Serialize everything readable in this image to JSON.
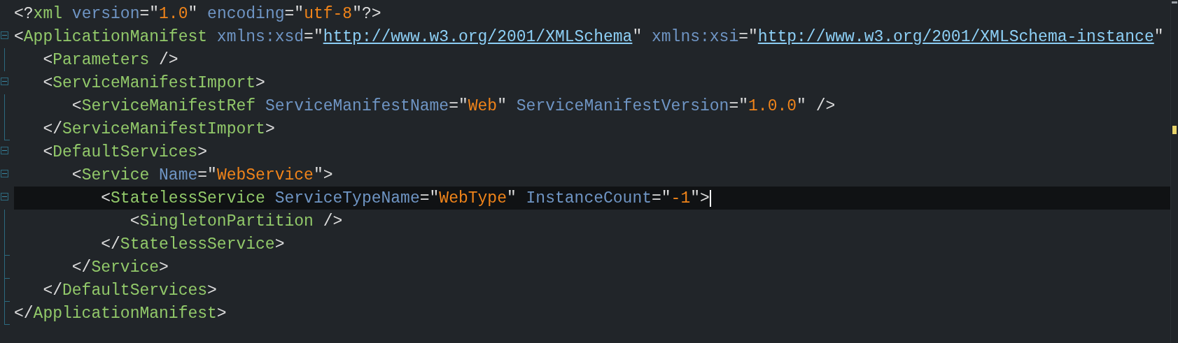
{
  "editor": {
    "lines": [
      {
        "current": false,
        "open": [
          {
            "kind": "punct",
            "text": "<?"
          },
          {
            "kind": "tag",
            "text": "xml"
          },
          {
            "kind": "attr",
            "text": " version"
          },
          {
            "kind": "punct",
            "text": "=\""
          },
          {
            "kind": "value",
            "text": "1.0"
          },
          {
            "kind": "punct",
            "text": "\""
          },
          {
            "kind": "attr",
            "text": " encoding"
          },
          {
            "kind": "punct",
            "text": "=\""
          },
          {
            "kind": "value",
            "text": "utf-8"
          },
          {
            "kind": "punct",
            "text": "\"?>"
          }
        ]
      },
      {
        "current": false,
        "expanded": true,
        "open": [
          {
            "kind": "punct",
            "text": "<"
          },
          {
            "kind": "tag",
            "text": "ApplicationManifest"
          },
          {
            "kind": "attr",
            "text": " xmlns:xsd"
          },
          {
            "kind": "punct",
            "text": "=\""
          },
          {
            "kind": "link",
            "text": "http://www.w3.org/2001/XMLSchema"
          },
          {
            "kind": "punct",
            "text": "\""
          },
          {
            "kind": "attr",
            "text": " xmlns:xsi"
          },
          {
            "kind": "punct",
            "text": "=\""
          },
          {
            "kind": "link",
            "text": "http://www.w3.org/2001/XMLSchema-instance"
          },
          {
            "kind": "punct",
            "text": "\""
          }
        ],
        "close": [
          {
            "kind": "punct",
            "text": "</"
          },
          {
            "kind": "tag",
            "text": "ApplicationManifest"
          },
          {
            "kind": "punct",
            "text": ">"
          }
        ],
        "children": [
          {
            "current": false,
            "open": [
              {
                "kind": "punct",
                "text": "<"
              },
              {
                "kind": "tag",
                "text": "Parameters"
              },
              {
                "kind": "punct",
                "text": " />"
              }
            ]
          },
          {
            "current": false,
            "expanded": true,
            "open": [
              {
                "kind": "punct",
                "text": "<"
              },
              {
                "kind": "tag",
                "text": "ServiceManifestImport"
              },
              {
                "kind": "punct",
                "text": ">"
              }
            ],
            "close": [
              {
                "kind": "punct",
                "text": "</"
              },
              {
                "kind": "tag",
                "text": "ServiceManifestImport"
              },
              {
                "kind": "punct",
                "text": ">"
              }
            ],
            "children": [
              {
                "current": false,
                "open": [
                  {
                    "kind": "punct",
                    "text": "<"
                  },
                  {
                    "kind": "tag",
                    "text": "ServiceManifestRef"
                  },
                  {
                    "kind": "attr",
                    "text": " ServiceManifestName"
                  },
                  {
                    "kind": "punct",
                    "text": "=\""
                  },
                  {
                    "kind": "value",
                    "text": "Web"
                  },
                  {
                    "kind": "punct",
                    "text": "\""
                  },
                  {
                    "kind": "attr",
                    "text": " ServiceManifestVersion"
                  },
                  {
                    "kind": "punct",
                    "text": "=\""
                  },
                  {
                    "kind": "value",
                    "text": "1.0.0"
                  },
                  {
                    "kind": "punct",
                    "text": "\" />"
                  }
                ]
              }
            ]
          },
          {
            "current": false,
            "expanded": true,
            "open": [
              {
                "kind": "punct",
                "text": "<"
              },
              {
                "kind": "tag",
                "text": "DefaultServices"
              },
              {
                "kind": "punct",
                "text": ">"
              }
            ],
            "close": [
              {
                "kind": "punct",
                "text": "</"
              },
              {
                "kind": "tag",
                "text": "DefaultServices"
              },
              {
                "kind": "punct",
                "text": ">"
              }
            ],
            "children": [
              {
                "current": false,
                "expanded": true,
                "open": [
                  {
                    "kind": "punct",
                    "text": "<"
                  },
                  {
                    "kind": "tag",
                    "text": "Service"
                  },
                  {
                    "kind": "attr",
                    "text": " Name"
                  },
                  {
                    "kind": "punct",
                    "text": "=\""
                  },
                  {
                    "kind": "value",
                    "text": "WebService"
                  },
                  {
                    "kind": "punct",
                    "text": "\">"
                  }
                ],
                "close": [
                  {
                    "kind": "punct",
                    "text": "</"
                  },
                  {
                    "kind": "tag",
                    "text": "Service"
                  },
                  {
                    "kind": "punct",
                    "text": ">"
                  }
                ],
                "children": [
                  {
                    "current": true,
                    "expanded": true,
                    "open": [
                      {
                        "kind": "punct",
                        "text": "<"
                      },
                      {
                        "kind": "tag",
                        "text": "StatelessService"
                      },
                      {
                        "kind": "attr",
                        "text": " ServiceTypeName"
                      },
                      {
                        "kind": "punct",
                        "text": "=\""
                      },
                      {
                        "kind": "value",
                        "text": "WebType"
                      },
                      {
                        "kind": "punct",
                        "text": "\""
                      },
                      {
                        "kind": "attr",
                        "text": " InstanceCount"
                      },
                      {
                        "kind": "punct",
                        "text": "=\""
                      },
                      {
                        "kind": "value",
                        "text": "-1"
                      },
                      {
                        "kind": "punct",
                        "text": "\">"
                      }
                    ],
                    "close": [
                      {
                        "kind": "punct",
                        "text": "</"
                      },
                      {
                        "kind": "tag",
                        "text": "StatelessService"
                      },
                      {
                        "kind": "punct",
                        "text": ">"
                      }
                    ],
                    "children": [
                      {
                        "current": false,
                        "open": [
                          {
                            "kind": "punct",
                            "text": "<"
                          },
                          {
                            "kind": "tag",
                            "text": "SingletonPartition"
                          },
                          {
                            "kind": "punct",
                            "text": " />"
                          }
                        ]
                      }
                    ]
                  }
                ]
              }
            ]
          }
        ]
      }
    ]
  }
}
